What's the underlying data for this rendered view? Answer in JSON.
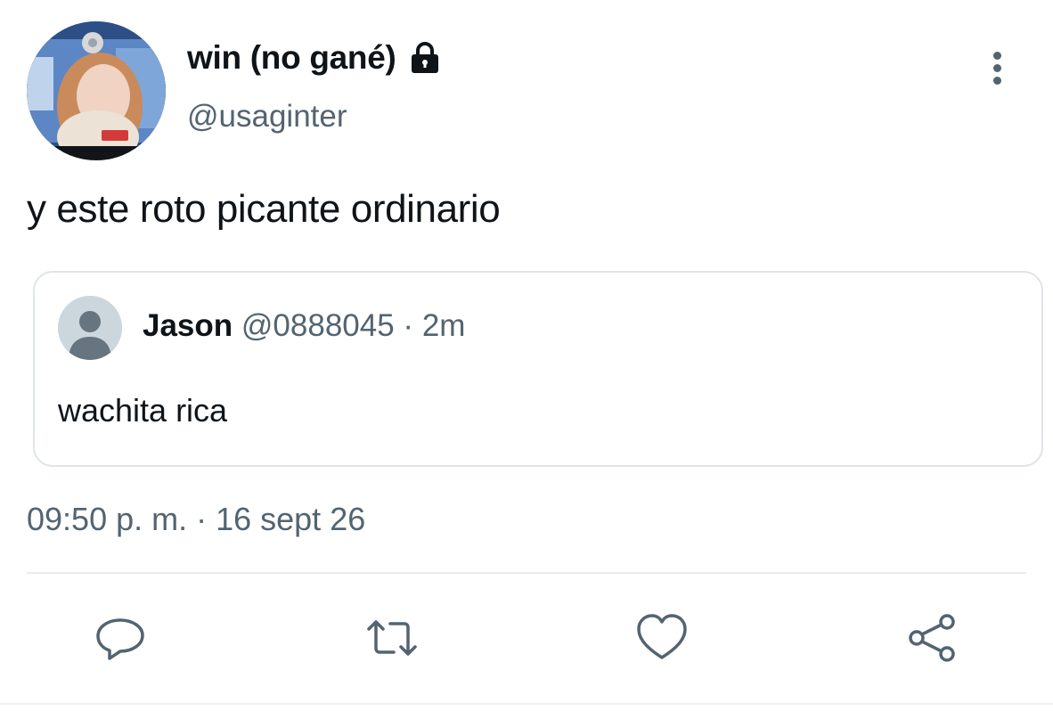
{
  "author": {
    "display_name": "win (no gané)",
    "handle": "@usaginter",
    "avatar_icon": "profile-photo",
    "protected_icon": "lock-icon"
  },
  "tweet": {
    "text": "y este roto picante ordinario",
    "timestamp": "09:50 p. m. · 16 sept 26"
  },
  "quoted_tweet": {
    "name": "Jason",
    "handle": "@0888045",
    "separator": "·",
    "age": "2m",
    "text": "wachita rica",
    "avatar_icon": "default-avatar-icon"
  },
  "actions": [
    {
      "name": "reply",
      "icon": "reply-icon"
    },
    {
      "name": "retweet",
      "icon": "retweet-icon"
    },
    {
      "name": "like",
      "icon": "heart-icon"
    },
    {
      "name": "share",
      "icon": "share-icon"
    }
  ],
  "colors": {
    "text_primary": "#0f1419",
    "text_secondary": "#536471",
    "border": "#dfe4e7",
    "icon": "#536471"
  }
}
